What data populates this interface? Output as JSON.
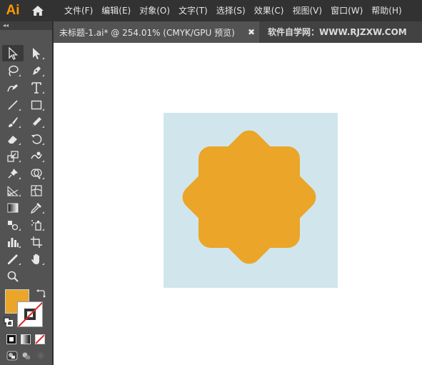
{
  "app": {
    "logo_text": "Ai"
  },
  "menu": [
    {
      "label": "文件(F)"
    },
    {
      "label": "编辑(E)"
    },
    {
      "label": "对象(O)"
    },
    {
      "label": "文字(T)"
    },
    {
      "label": "选择(S)"
    },
    {
      "label": "效果(C)"
    },
    {
      "label": "视图(V)"
    },
    {
      "label": "窗口(W)"
    },
    {
      "label": "帮助(H)"
    }
  ],
  "panel": {
    "collapse_glyph": "◂◂"
  },
  "document": {
    "tab_title": "未标题-1.ai* @ 254.01% (CMYK/GPU 预览)",
    "close_glyph": "✖",
    "watermark": "软件自学网：WWW.RJZXW.COM"
  },
  "tools": [
    [
      "selection-tool",
      "direct-selection-tool"
    ],
    [
      "lasso-tool",
      "pen-tool"
    ],
    [
      "curvature-tool",
      "type-tool"
    ],
    [
      "line-segment-tool",
      "rectangle-tool"
    ],
    [
      "paintbrush-tool",
      "pencil-tool"
    ],
    [
      "eraser-tool",
      "rotate-tool"
    ],
    [
      "scale-tool",
      "warp-tool"
    ],
    [
      "puppet-warp-tool",
      "shape-builder-tool"
    ],
    [
      "perspective-grid-tool",
      "mesh-tool"
    ],
    [
      "gradient-tool",
      "eyedropper-tool"
    ],
    [
      "blend-tool",
      "symbol-sprayer-tool"
    ],
    [
      "column-graph-tool",
      "artboard-tool"
    ],
    [
      "slice-tool",
      "hand-tool"
    ],
    [
      "zoom-tool",
      ""
    ]
  ],
  "colors": {
    "fill": "#eba528",
    "stroke": "none",
    "artboard_bg": "#d0e6ec",
    "shape_fill": "#eba528"
  }
}
